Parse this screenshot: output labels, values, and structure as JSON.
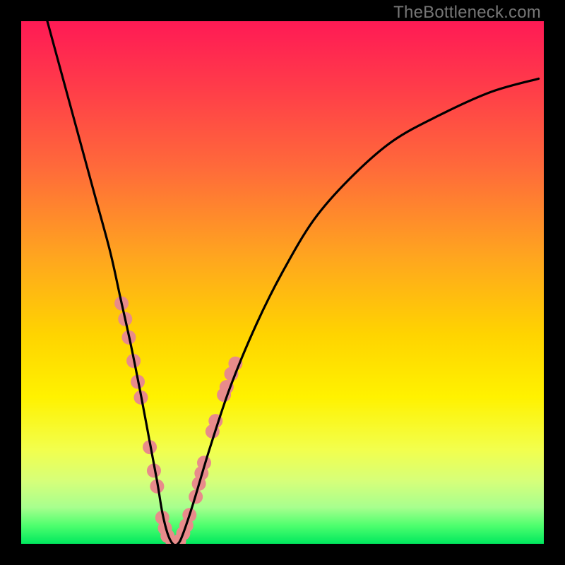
{
  "watermark": "TheBottleneck.com",
  "chart_data": {
    "type": "line",
    "title": "",
    "xlabel": "",
    "ylabel": "",
    "xlim": [
      0,
      100
    ],
    "ylim": [
      0,
      100
    ],
    "grid": false,
    "legend": false,
    "gradient_stops": [
      {
        "offset": 0.0,
        "color": "#ff1a55"
      },
      {
        "offset": 0.12,
        "color": "#ff3a4a"
      },
      {
        "offset": 0.28,
        "color": "#ff6a3a"
      },
      {
        "offset": 0.45,
        "color": "#ffa51f"
      },
      {
        "offset": 0.6,
        "color": "#ffd400"
      },
      {
        "offset": 0.72,
        "color": "#fff200"
      },
      {
        "offset": 0.82,
        "color": "#f2ff4d"
      },
      {
        "offset": 0.88,
        "color": "#d6ff7a"
      },
      {
        "offset": 0.93,
        "color": "#a8ff8e"
      },
      {
        "offset": 0.965,
        "color": "#4eff6e"
      },
      {
        "offset": 1.0,
        "color": "#00e85e"
      }
    ],
    "series": [
      {
        "name": "bottleneck-curve",
        "x": [
          5.0,
          8.0,
          11.0,
          14.0,
          17.0,
          19.0,
          21.0,
          23.0,
          24.5,
          26.0,
          27.0,
          28.0,
          29.0,
          30.0,
          31.0,
          33.0,
          36.0,
          40.0,
          45.0,
          50.0,
          56.0,
          63.0,
          71.0,
          80.0,
          90.0,
          99.0
        ],
        "values": [
          100.0,
          89.0,
          78.0,
          67.0,
          56.0,
          47.0,
          38.0,
          28.0,
          20.0,
          12.0,
          6.0,
          2.0,
          0.0,
          0.0,
          2.0,
          8.0,
          18.0,
          30.0,
          42.0,
          52.0,
          62.0,
          70.0,
          77.0,
          82.0,
          86.5,
          89.0
        ]
      }
    ],
    "markers": {
      "color": "#e88b8b",
      "radius": 10,
      "points": [
        {
          "x": 19.2,
          "y": 46.0
        },
        {
          "x": 19.9,
          "y": 43.0
        },
        {
          "x": 20.6,
          "y": 39.5
        },
        {
          "x": 21.5,
          "y": 35.0
        },
        {
          "x": 22.3,
          "y": 31.0
        },
        {
          "x": 22.9,
          "y": 28.0
        },
        {
          "x": 24.6,
          "y": 18.5
        },
        {
          "x": 25.4,
          "y": 14.0
        },
        {
          "x": 26.0,
          "y": 11.0
        },
        {
          "x": 27.0,
          "y": 5.0
        },
        {
          "x": 27.5,
          "y": 3.0
        },
        {
          "x": 28.0,
          "y": 1.5
        },
        {
          "x": 29.0,
          "y": 0.0
        },
        {
          "x": 30.2,
          "y": 0.5
        },
        {
          "x": 31.0,
          "y": 2.0
        },
        {
          "x": 31.6,
          "y": 3.5
        },
        {
          "x": 32.2,
          "y": 5.5
        },
        {
          "x": 33.4,
          "y": 9.0
        },
        {
          "x": 34.0,
          "y": 11.5
        },
        {
          "x": 34.5,
          "y": 13.5
        },
        {
          "x": 35.0,
          "y": 15.5
        },
        {
          "x": 36.6,
          "y": 21.5
        },
        {
          "x": 37.2,
          "y": 23.5
        },
        {
          "x": 38.8,
          "y": 28.5
        },
        {
          "x": 39.3,
          "y": 30.0
        },
        {
          "x": 40.2,
          "y": 32.5
        },
        {
          "x": 41.0,
          "y": 34.5
        }
      ]
    }
  }
}
